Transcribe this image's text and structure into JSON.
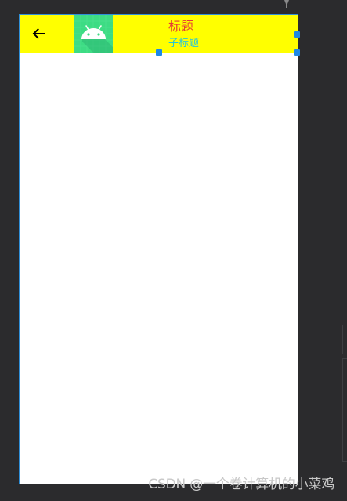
{
  "toolbar": {
    "title": "标题",
    "subtitle": "子标题",
    "title_color": "#e53935",
    "subtitle_color": "#26c6da",
    "background_color": "#ffff00",
    "back_icon": "arrow-back-icon",
    "logo_icon": "android-logo-icon",
    "logo_color": "#3ddc84"
  },
  "watermark": {
    "text": "CSDN @一个卷计算机的小菜鸡",
    "color": "#c8c8c8"
  },
  "colors": {
    "editor_background": "#2b2b2d",
    "selection_accent": "#1e88e5",
    "device_background": "#ffffff"
  }
}
